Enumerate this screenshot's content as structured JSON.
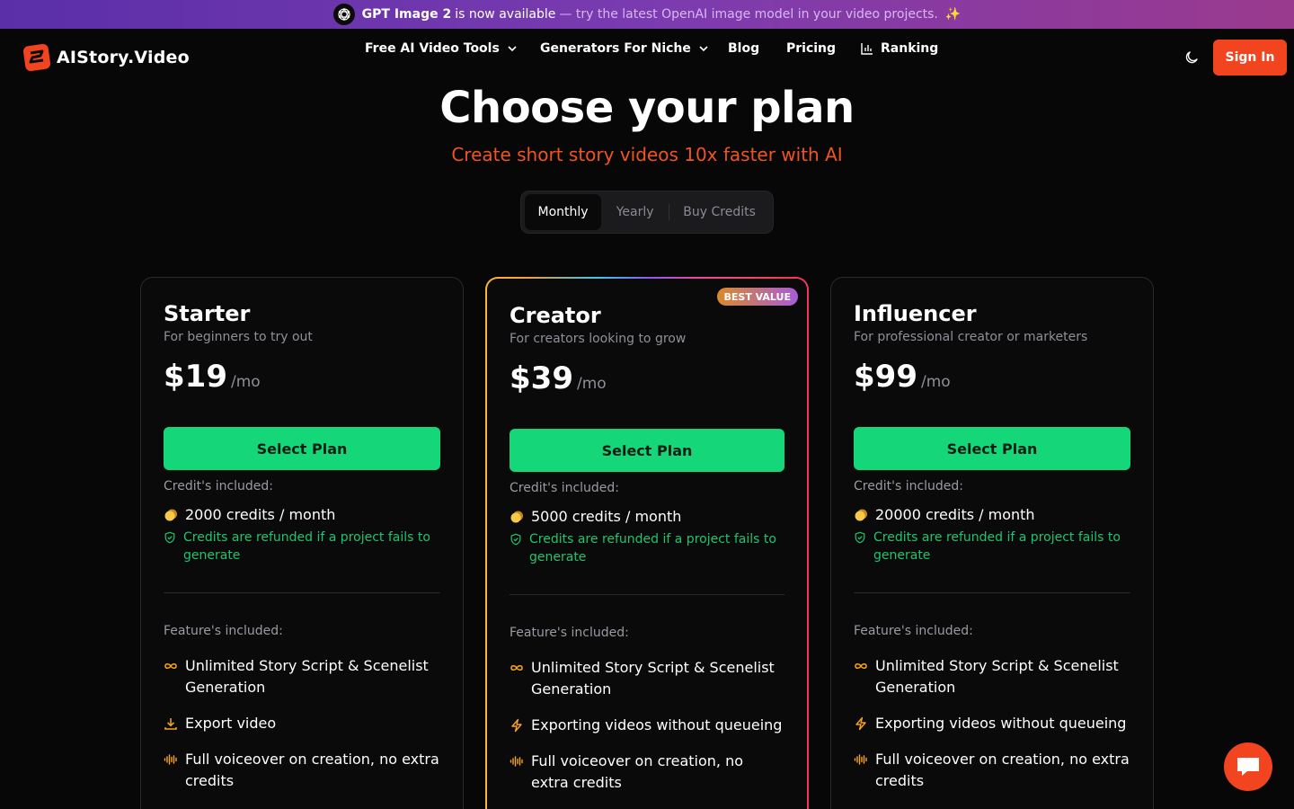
{
  "banner": {
    "strong": "GPT Image 2",
    "normal": "is now available",
    "muted": "— try the latest OpenAI image model in your video projects.",
    "sparkle": "✨"
  },
  "brand": {
    "name": "AIStory.Video"
  },
  "nav": {
    "items": [
      {
        "label": "Free AI Video Tools",
        "dropdown": true
      },
      {
        "label": "Generators For Niche",
        "dropdown": true
      },
      {
        "label": "Blog"
      },
      {
        "label": "Pricing"
      },
      {
        "label": "Ranking",
        "icon": "bar-chart-icon"
      }
    ],
    "theme_icon": "moon-icon",
    "signin": "Sign In"
  },
  "hero": {
    "title": "Choose your plan",
    "subtitle": "Create short story videos 10x faster with AI"
  },
  "billing_toggle": {
    "options": [
      "Monthly",
      "Yearly",
      "Buy Credits"
    ],
    "selected": "Monthly"
  },
  "colors": {
    "accent": "#f0541f",
    "cta": "#16d67a",
    "signin": "#f2441f",
    "refund": "#1fc46d"
  },
  "plans": [
    {
      "name": "Starter",
      "desc": "For beginners to try out",
      "price": "$19",
      "per": "/mo",
      "cta": "Select Plan",
      "credits_label": "Credit's included:",
      "credits": "2000 credits / month",
      "refund": "Credits are refunded if a project fails to generate",
      "features_label": "Feature's included:",
      "features": [
        {
          "icon": "infinity-icon",
          "text": "Unlimited Story Script & Scenelist Generation"
        },
        {
          "icon": "download-icon",
          "text": "Export video"
        },
        {
          "icon": "waveform-icon",
          "text": "Full voiceover on creation, no extra credits"
        }
      ]
    },
    {
      "name": "Creator",
      "desc": "For creators looking to grow",
      "price": "$39",
      "per": "/mo",
      "badge": "BEST VALUE",
      "cta": "Select Plan",
      "credits_label": "Credit's included:",
      "credits": "5000 credits / month",
      "refund": "Credits are refunded if a project fails to generate",
      "features_label": "Feature's included:",
      "features": [
        {
          "icon": "infinity-icon",
          "text": "Unlimited Story Script & Scenelist Generation"
        },
        {
          "icon": "lightning-icon",
          "text": "Exporting videos without queueing"
        },
        {
          "icon": "waveform-icon",
          "text": "Full voiceover on creation, no extra credits"
        }
      ]
    },
    {
      "name": "Influencer",
      "desc": "For professional creator or marketers",
      "price": "$99",
      "per": "/mo",
      "cta": "Select Plan",
      "credits_label": "Credit's included:",
      "credits": "20000 credits / month",
      "refund": "Credits are refunded if a project fails to generate",
      "features_label": "Feature's included:",
      "features": [
        {
          "icon": "infinity-icon",
          "text": "Unlimited Story Script & Scenelist Generation"
        },
        {
          "icon": "lightning-icon",
          "text": "Exporting videos without queueing"
        },
        {
          "icon": "waveform-icon",
          "text": "Full voiceover on creation, no extra credits"
        }
      ]
    }
  ],
  "chat": {
    "icon": "chat-bubble-icon"
  }
}
